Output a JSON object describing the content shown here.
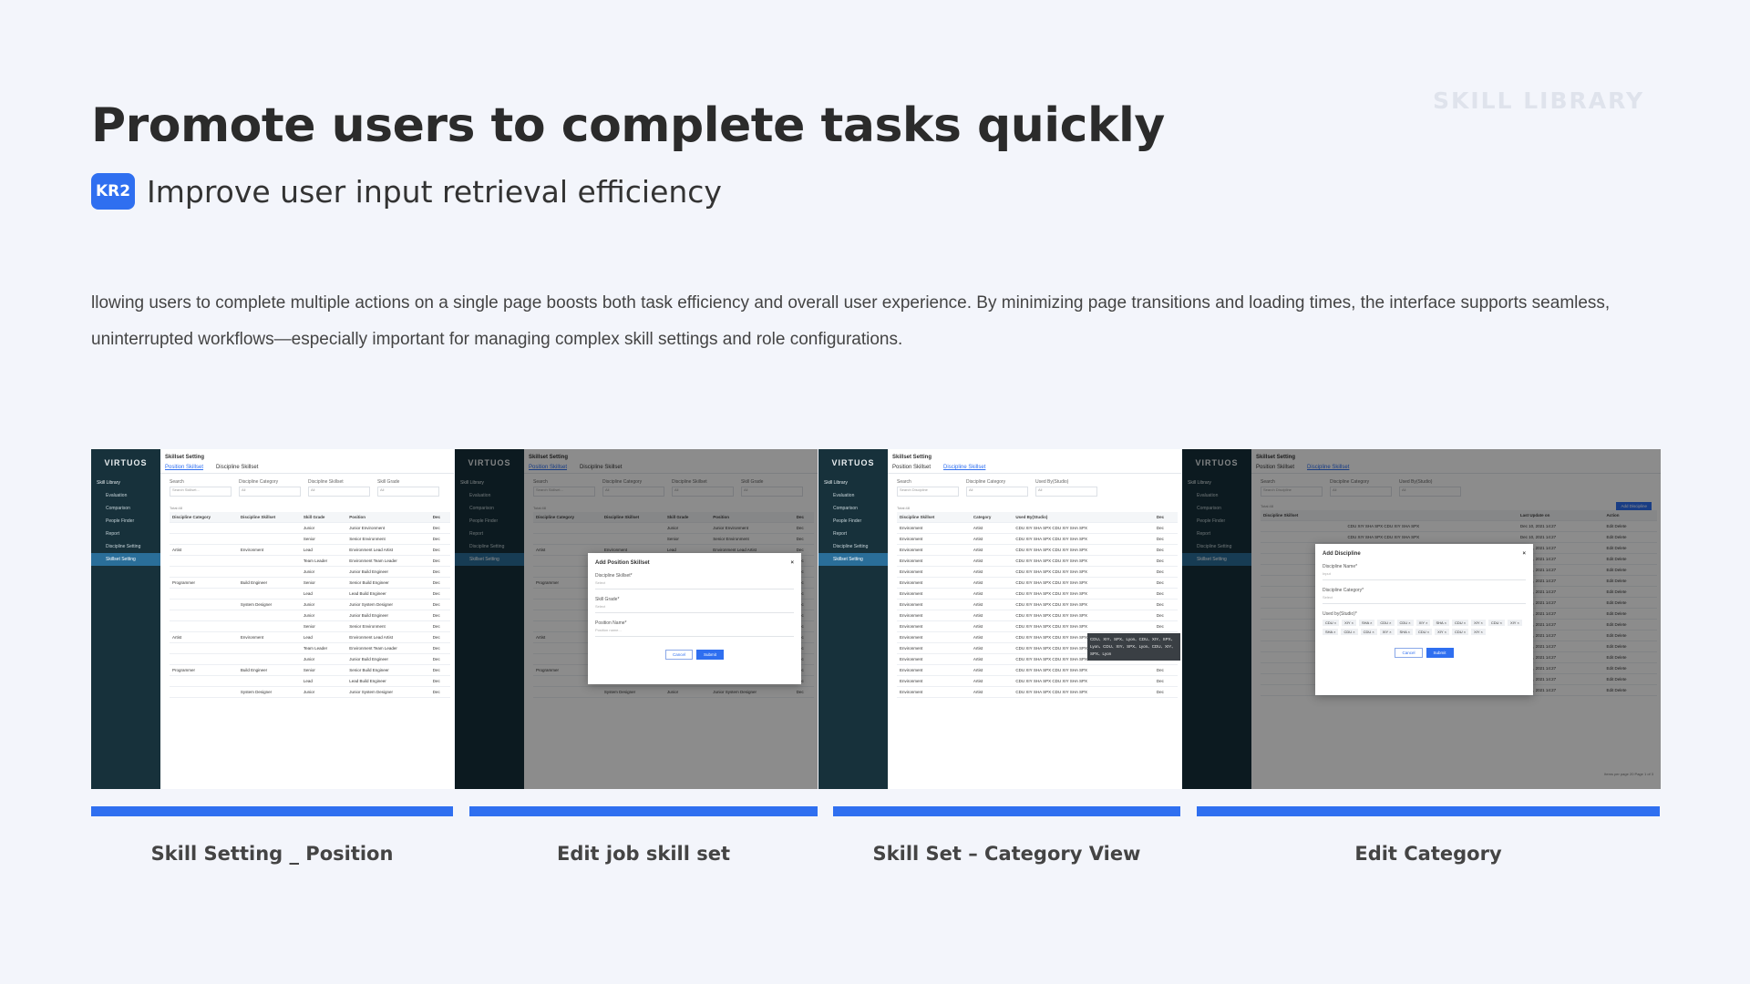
{
  "watermark": "SKILL LIBRARY",
  "title": "Promote users to complete tasks quickly",
  "badge": "KR2",
  "subtitle": "Improve user input retrieval efficiency",
  "description": "llowing users to complete multiple actions on a single page boosts both task efficiency and overall user experience. By minimizing page transitions and loading times, the interface supports seamless, uninterrupted workflows—especially important for managing complex skill settings and role configurations.",
  "captions": [
    "Skill Setting _ Position",
    "Edit job skill set",
    "Skill Set – Category View",
    "Edit Category"
  ],
  "mock": {
    "logo": "VIRTUOS",
    "nav_header": "Skill Library",
    "nav": [
      "Evaluation",
      "Comparison",
      "People Finder",
      "Report",
      "Discipline Setting",
      "Skillset Setting"
    ],
    "page_title": "Skillset Setting",
    "tabs": [
      "Position Skillset",
      "Discipline Skillset"
    ],
    "filter_search": "Search",
    "filter_search_ph": "Search Skillset...",
    "filter_cat": "Discipline Category",
    "filter_skillset": "Discipline Skillset",
    "filter_grade": "Skill Grade",
    "filter_all": "All",
    "total": "Total:48",
    "cols1": [
      "Discipline Category",
      "Discipline Skillset",
      "Skill Grade",
      "Position",
      "Dec"
    ],
    "rows1": [
      [
        "",
        "",
        "Junior",
        "Junior Environment",
        "Dec"
      ],
      [
        "",
        "",
        "Senior",
        "Senior Environment",
        "Dec"
      ],
      [
        "Artist",
        "Environment",
        "Lead",
        "Environment Lead Artist",
        "Dec"
      ],
      [
        "",
        "",
        "Team Leader",
        "Environment Team Leader",
        "Dec"
      ],
      [
        "",
        "",
        "Junior",
        "Junior Build Engineer",
        "Dec"
      ],
      [
        "Programmer",
        "Build Engineer",
        "Senior",
        "Senior Build Engineer",
        "Dec"
      ],
      [
        "",
        "",
        "Lead",
        "Lead Build Engineer",
        "Dec"
      ],
      [
        "",
        "System Designer",
        "Junior",
        "Junior System Designer",
        "Dec"
      ],
      [
        "",
        "",
        "Junior",
        "Junior Build Engineer",
        "Dec"
      ],
      [
        "",
        "",
        "Senior",
        "Senior Environment",
        "Dec"
      ],
      [
        "Artist",
        "Environment",
        "Lead",
        "Environment Lead Artist",
        "Dec"
      ],
      [
        "",
        "",
        "Team Leader",
        "Environment Team Leader",
        "Dec"
      ],
      [
        "",
        "",
        "Junior",
        "Junior Build Engineer",
        "Dec"
      ],
      [
        "Programmer",
        "Build Engineer",
        "Senior",
        "Senior Build Engineer",
        "Dec"
      ],
      [
        "",
        "",
        "Lead",
        "Lead Build Engineer",
        "Dec"
      ],
      [
        "",
        "System Designer",
        "Junior",
        "Junior System Designer",
        "Dec"
      ]
    ],
    "modal2": {
      "title": "Add Position Skillset",
      "f1": "Discipline Skillset*",
      "f1ph": "Select",
      "f2": "Skill Grade*",
      "f2ph": "Select",
      "f3": "Position Name*",
      "f3ph": "Position name...",
      "cancel": "Cancel",
      "submit": "Submit"
    },
    "filter_used": "Used By(Studio)",
    "filter_search_ph3": "Search Discipline",
    "cols3": [
      "Discipline Skillset",
      "Category",
      "Used By(Studio)",
      "Dec"
    ],
    "row3": [
      "Environment",
      "Artist",
      "CDU  XIY  SHA  SPX  CDU  XIY  SHA  SPX",
      "Dec"
    ],
    "tooltip": "CDU、XIY、SPX、Lyon、CDU、XIY、SPX、Lyon、CDU、XIY、SPX、Lyon、CDU、XIY、SPX、Lyon",
    "add_button": "Add Discipline",
    "modal4": {
      "title": "Add Discipline",
      "f1": "Discipline Name*",
      "f1ph": "Input",
      "f2": "Discipline Category*",
      "f2ph": "Select",
      "f3": "Used by(Studio)*",
      "chips": [
        "CDU ×",
        "XIY ×",
        "SHA ×",
        "CDU ×",
        "CDU ×",
        "XIY ×",
        "SHA ×",
        "CDU ×",
        "XIY ×",
        "CDU ×",
        "XIY ×",
        "SHA ×",
        "CDU ×",
        "CDU ×",
        "XIY ×",
        "SHA ×",
        "CDU ×",
        "XIY ×",
        "CDU ×",
        "XIY ×"
      ],
      "cancel": "Cancel",
      "submit": "Submit"
    },
    "cols4": [
      "Discipline Skillset",
      "",
      "",
      "Last Update on",
      "Action"
    ],
    "row4": [
      "",
      "CDU  XIY  SHA  SPX  CDU  XIY  SHA  SPX",
      "",
      "Dec 10, 2021 14:27",
      "Edit  Delete"
    ],
    "pagination": "Items per page 20   Page 1 of 3"
  }
}
